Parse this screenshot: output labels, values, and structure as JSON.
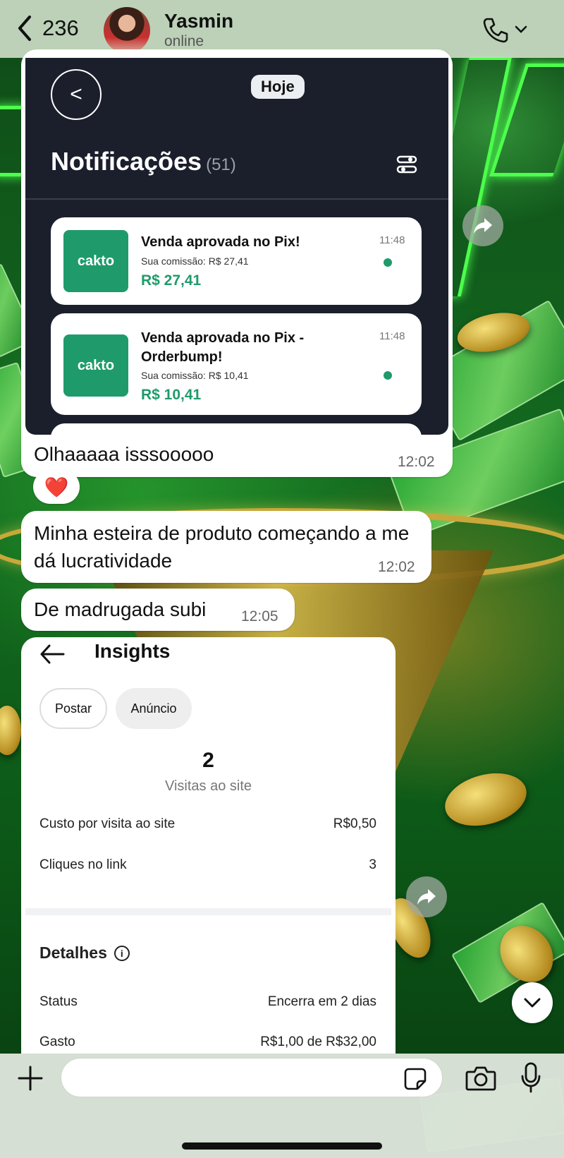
{
  "header": {
    "back_count": "236",
    "contact_name": "Yasmin",
    "contact_status": "online"
  },
  "notification_image": {
    "date_chip": "Hoje",
    "title": "Notificações",
    "count": "(51)",
    "cards": [
      {
        "logo": "cakto",
        "title": "Venda aprovada no Pix!",
        "commission": "Sua comissão: R$ 27,41",
        "amount": "R$ 27,41",
        "time": "11:48"
      },
      {
        "logo": "cakto",
        "title": "Venda aprovada no Pix - Orderbump!",
        "commission": "Sua comissão: R$ 10,41",
        "amount": "R$ 10,41",
        "time": "11:48"
      }
    ]
  },
  "messages": [
    {
      "text": "Olhaaaaa isssooooo",
      "time": "12:02"
    },
    {
      "text": "Minha esteira de produto começando a me dá lucratividade",
      "time": "12:02"
    },
    {
      "text": "De madrugada subi",
      "time": "12:05"
    }
  ],
  "reaction": "❤️",
  "insights": {
    "title": "Insights",
    "tabs": [
      "Postar",
      "Anúncio"
    ],
    "metric_value": "2",
    "metric_label": "Visitas ao site",
    "rows": [
      {
        "label": "Custo por visita ao site",
        "value": "R$0,50"
      },
      {
        "label": "Cliques no link",
        "value": "3"
      }
    ],
    "details_title": "Detalhes",
    "details": [
      {
        "label": "Status",
        "value": "Encerra em 2 dias"
      },
      {
        "label": "Gasto",
        "value": "R$1,00 de R$32,00"
      }
    ]
  },
  "icons": {
    "back": "chevron-left-icon",
    "call": "phone-icon",
    "forward": "forward-arrow-icon",
    "scroll": "chevron-down-icon",
    "attach": "plus-icon",
    "sticker": "sticker-icon",
    "camera": "camera-icon",
    "mic": "microphone-icon"
  }
}
